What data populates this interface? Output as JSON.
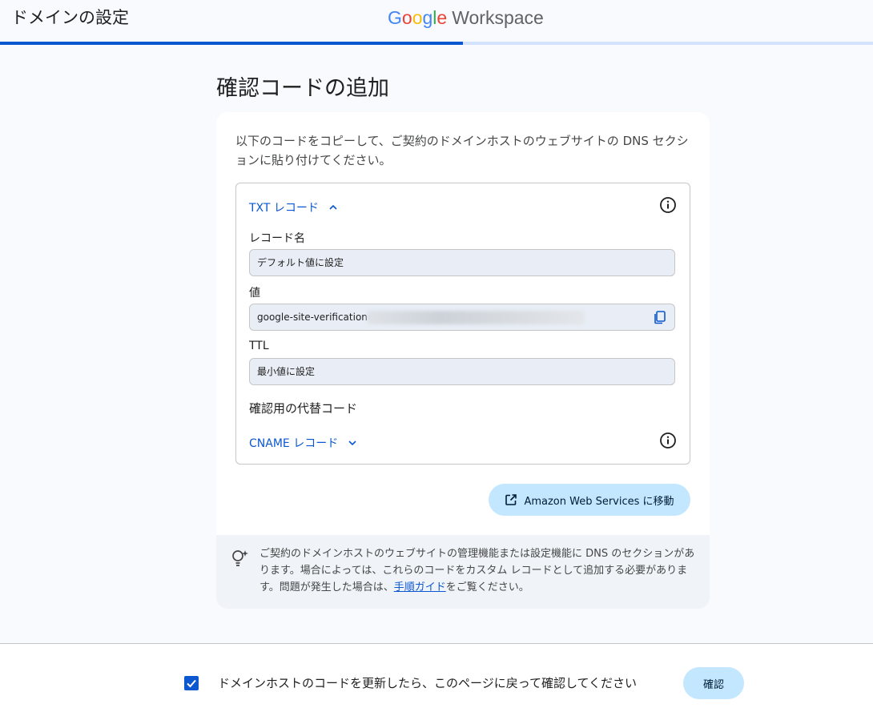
{
  "header": {
    "page_title": "ドメインの設定",
    "brand_google": [
      "G",
      "o",
      "o",
      "g",
      "l",
      "e"
    ],
    "brand_product": "Workspace",
    "progress": 0.53
  },
  "main": {
    "title": "確認コードの追加",
    "intro": "以下のコードをコピーして、ご契約のドメインホストのウェブサイトの DNS セクションに貼り付けてください。"
  },
  "record": {
    "header_label": "TXT レコード",
    "name_label": "レコード名",
    "name_value": "デフォルト値に設定",
    "value_label": "値",
    "value_text": "google-site-verification=",
    "ttl_label": "TTL",
    "ttl_value": "最小値に設定",
    "alt_label": "確認用の代替コード",
    "cname_label": "CNAME レコード"
  },
  "aws_button_label": "Amazon Web Services に移動",
  "tip": {
    "text_before": "ご契約のドメインホストのウェブサイトの管理機能または設定機能に DNS のセクションがあります。場合によっては、これらのコードをカスタム レコードとして追加する必要があります。問題が発生した場合は、",
    "link_text": "手順ガイド",
    "text_after": "をご覧ください。"
  },
  "footer": {
    "checkbox_label": "ドメインホストのコードを更新したら、このページに戻って確認してください",
    "checked": true,
    "confirm_label": "確認"
  },
  "colors": {
    "accent": "#0b57d0",
    "button_bg": "#c2e7ff",
    "field_bg": "#e9eef6"
  },
  "icons": [
    "info-icon",
    "copy-icon",
    "open-in-new-icon",
    "lightbulb-icon",
    "chevron-up-icon",
    "chevron-down-icon",
    "checkmark-icon"
  ]
}
